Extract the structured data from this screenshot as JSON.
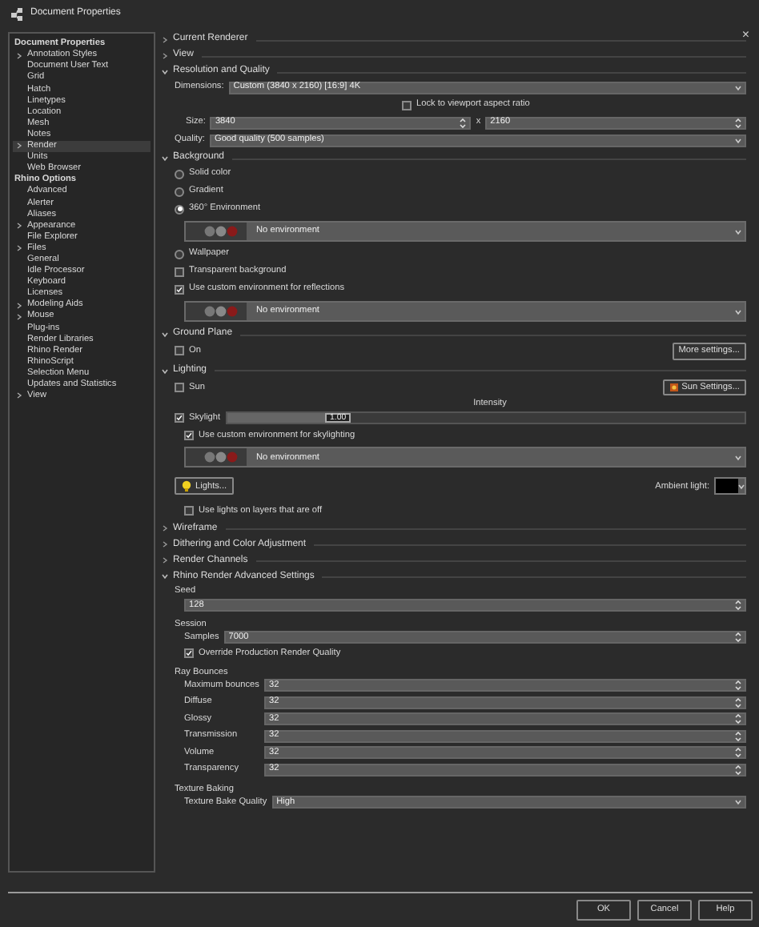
{
  "window": {
    "title": "Document Properties",
    "close": "×"
  },
  "tree": [
    {
      "label": "Document Properties",
      "selected": false,
      "children": [
        {
          "label": "Annotation Styles",
          "kind": "folder",
          "selected": false
        },
        {
          "label": "Document User Text",
          "kind": "leaf",
          "selected": false
        },
        {
          "label": "Grid",
          "kind": "leaf",
          "selected": false
        },
        {
          "label": "Hatch",
          "kind": "leaf",
          "selected": false
        },
        {
          "label": "Linetypes",
          "kind": "leaf",
          "selected": false
        },
        {
          "label": "Location",
          "kind": "leaf",
          "selected": false
        },
        {
          "label": "Mesh",
          "kind": "leaf",
          "selected": false
        },
        {
          "label": "Notes",
          "kind": "leaf",
          "selected": false
        },
        {
          "label": "Render",
          "kind": "folder",
          "selected": true
        },
        {
          "label": "Units",
          "kind": "leaf",
          "selected": false
        },
        {
          "label": "Web Browser",
          "kind": "leaf",
          "selected": false
        }
      ]
    },
    {
      "label": "Rhino Options",
      "selected": false,
      "children": [
        {
          "label": "Advanced",
          "kind": "leaf",
          "selected": false
        },
        {
          "label": "Alerter",
          "kind": "leaf",
          "selected": false
        },
        {
          "label": "Aliases",
          "kind": "leaf",
          "selected": false
        },
        {
          "label": "Appearance",
          "kind": "folder",
          "selected": false
        },
        {
          "label": "File Explorer",
          "kind": "leaf",
          "selected": false
        },
        {
          "label": "Files",
          "kind": "folder",
          "selected": false
        },
        {
          "label": "General",
          "kind": "leaf",
          "selected": false
        },
        {
          "label": "Idle Processor",
          "kind": "leaf",
          "selected": false
        },
        {
          "label": "Keyboard",
          "kind": "leaf",
          "selected": false
        },
        {
          "label": "Licenses",
          "kind": "leaf",
          "selected": false
        },
        {
          "label": "Modeling Aids",
          "kind": "folder",
          "selected": false
        },
        {
          "label": "Mouse",
          "kind": "folder",
          "selected": false
        },
        {
          "label": "Plug-ins",
          "kind": "leaf",
          "selected": false
        },
        {
          "label": "Render Libraries",
          "kind": "leaf",
          "selected": false
        },
        {
          "label": "Rhino Render",
          "kind": "leaf",
          "selected": false
        },
        {
          "label": "RhinoScript",
          "kind": "leaf",
          "selected": false
        },
        {
          "label": "Selection Menu",
          "kind": "leaf",
          "selected": false
        },
        {
          "label": "Updates and Statistics",
          "kind": "leaf",
          "selected": false
        },
        {
          "label": "View",
          "kind": "folder",
          "selected": false
        }
      ]
    }
  ],
  "sections": [
    {
      "title": "Current Renderer",
      "expanded": false
    },
    {
      "title": "View",
      "expanded": false
    },
    {
      "title": "Resolution and Quality",
      "expanded": true,
      "rows": [
        {
          "kind": "select",
          "label": "Dimensions:",
          "value": "Custom (3840 x 2160) [16:9] 4K"
        },
        {
          "kind": "offsetcheck",
          "label": "Lock to viewport aspect ratio",
          "checked": false
        },
        {
          "kind": "pair",
          "label": "Size:",
          "value": "3840",
          "separator": "x",
          "value2": "2160"
        },
        {
          "kind": "select",
          "label": "Quality:",
          "value": "Good quality (500 samples)"
        }
      ]
    },
    {
      "title": "Background",
      "expanded": true,
      "rows": [
        {
          "kind": "radio",
          "label": "Solid color",
          "selected": false
        },
        {
          "kind": "radio",
          "label": "Gradient",
          "selected": false
        },
        {
          "kind": "radio",
          "label": "360° Environment",
          "selected": true
        },
        {
          "kind": "env",
          "value": "No environment"
        },
        {
          "kind": "radio",
          "label": "Wallpaper",
          "selected": false
        },
        {
          "kind": "check",
          "label": "Transparent background",
          "checked": false
        },
        {
          "kind": "check",
          "label": "Use custom environment for reflections",
          "checked": true
        },
        {
          "kind": "env",
          "value": "No environment"
        }
      ]
    },
    {
      "title": "Ground Plane",
      "expanded": true,
      "rows": [
        {
          "kind": "checkbutton",
          "label": "On",
          "checked": false,
          "button": "More settings...",
          "icon": false
        }
      ]
    },
    {
      "title": "Lighting",
      "expanded": true,
      "rows": [
        {
          "kind": "checkbutton",
          "label": "Sun",
          "checked": false,
          "button": "Sun Settings...",
          "icon": true
        },
        {
          "kind": "slider",
          "caption": "Intensity",
          "label": "Skylight",
          "checked": true,
          "level": 0.19,
          "value": "1.00"
        },
        {
          "kind": "subcheck",
          "label": "Use custom environment for skylighting",
          "checked": true
        },
        {
          "kind": "env",
          "value": "No environment"
        },
        {
          "kind": "lights",
          "button": "Lights...",
          "label": "Ambient light:"
        },
        {
          "kind": "subcheck",
          "label": "Use lights on layers that are off",
          "checked": false
        }
      ]
    },
    {
      "title": "Wireframe",
      "expanded": false
    },
    {
      "title": "Dithering and Color Adjustment",
      "expanded": false
    },
    {
      "title": "Render Channels",
      "expanded": false
    },
    {
      "title": "Rhino Render Advanced Settings",
      "expanded": true,
      "rows": [
        {
          "kind": "group",
          "title": "Seed",
          "rows": [
            {
              "kind": "spin",
              "value": "128"
            }
          ]
        },
        {
          "kind": "group",
          "title": "Session",
          "rows": [
            {
              "kind": "spin",
              "label": "Samples",
              "value": "7000"
            },
            {
              "kind": "check",
              "label": "Override Production Render Quality",
              "checked": true
            }
          ]
        },
        {
          "kind": "group",
          "title": "Ray Bounces",
          "rows": [
            {
              "kind": "spin",
              "label": "Maximum bounces",
              "value": "32"
            },
            {
              "kind": "spin",
              "label": "Diffuse",
              "value": "32"
            },
            {
              "kind": "spin",
              "label": "Glossy",
              "value": "32"
            },
            {
              "kind": "spin",
              "label": "Transmission",
              "value": "32"
            },
            {
              "kind": "spin",
              "label": "Volume",
              "value": "32"
            },
            {
              "kind": "spin",
              "label": "Transparency",
              "value": "32"
            }
          ]
        },
        {
          "kind": "group",
          "title": "Texture Baking",
          "rows": [
            {
              "kind": "select",
              "label": "Texture Bake Quality",
              "value": "High"
            }
          ]
        }
      ]
    }
  ],
  "buttons": [
    "OK",
    "Cancel",
    "Help"
  ]
}
